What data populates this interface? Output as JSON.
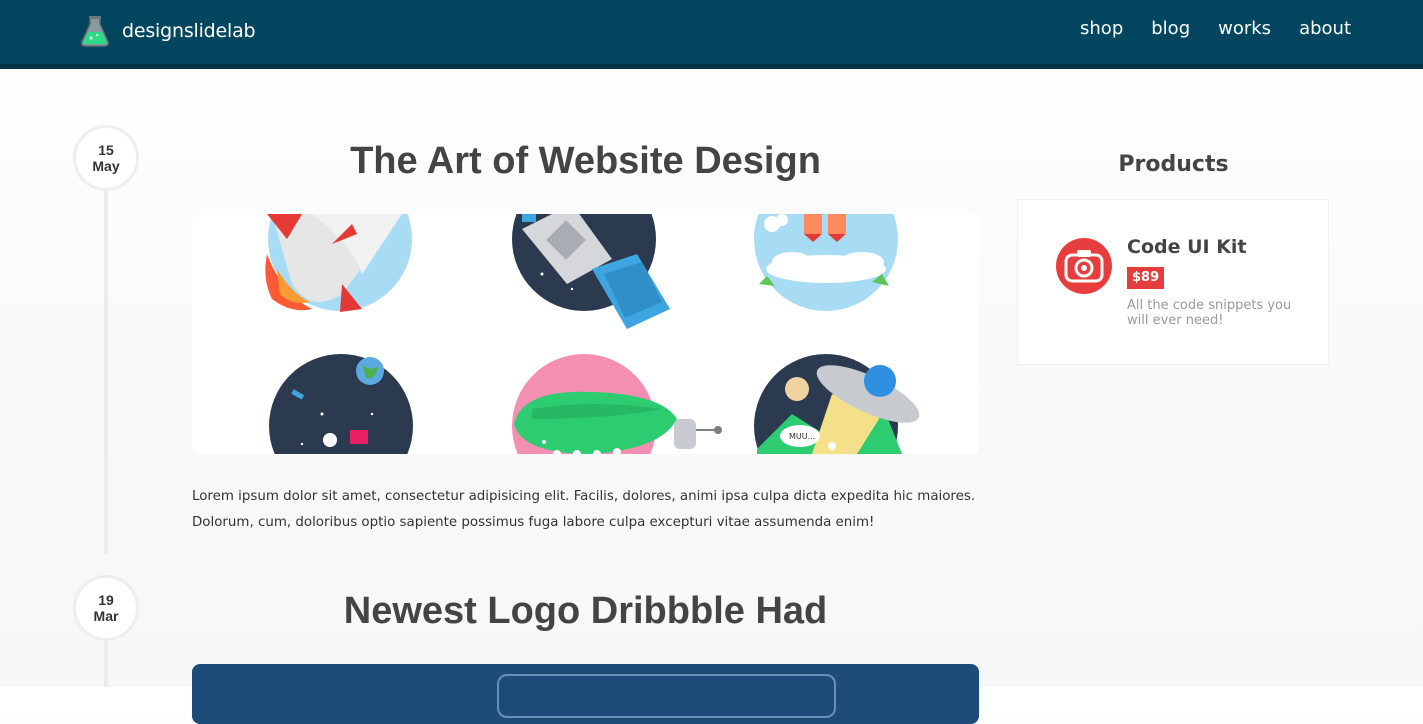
{
  "header": {
    "brand": "designslidelab",
    "nav": [
      "shop",
      "blog",
      "works",
      "about"
    ]
  },
  "posts": [
    {
      "day": "15",
      "month": "May",
      "title": "The Art of Website Design",
      "body": "Lorem ipsum dolor sit amet, consectetur adipisicing elit. Facilis, dolores, animi ipsa culpa dicta expedita hic maiores. Dolorum, cum, doloribus optio sapiente possimus fuga labore culpa excepturi vitae assumenda enim!",
      "image_label": "MUU..."
    },
    {
      "day": "19",
      "month": "Mar",
      "title": "Newest Logo Dribbble Had"
    }
  ],
  "sidebar": {
    "title": "Products",
    "product": {
      "name": "Code UI Kit",
      "price": "$89",
      "description": "All the code snippets you will ever need!"
    }
  },
  "colors": {
    "header_bg": "#01465e",
    "price_badge": "#e83d3d",
    "product_icon": "#e83d3d"
  },
  "icons": [
    "flask-logo-icon",
    "camera-icon"
  ]
}
